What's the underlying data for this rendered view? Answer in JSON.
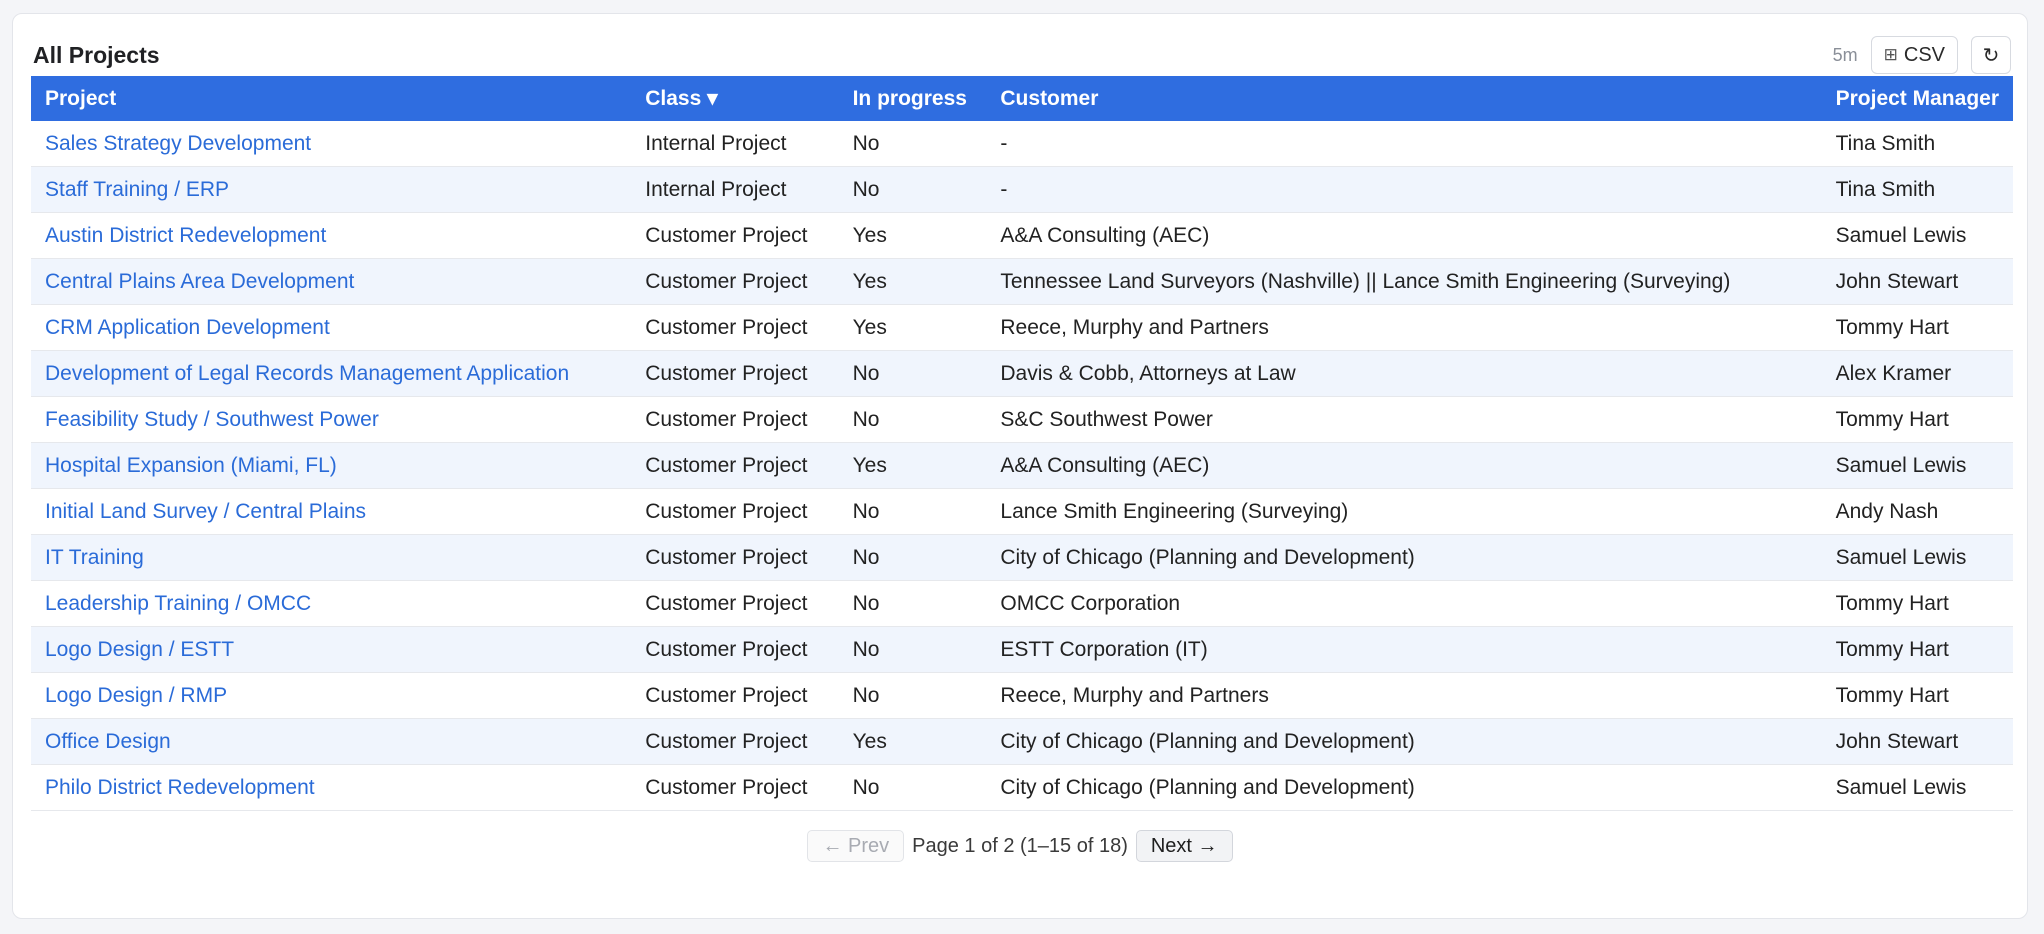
{
  "panel": {
    "title": "All Projects",
    "refresh_interval": "5m",
    "csv_icon": "grid-icon",
    "csv_glyph": "⊞",
    "csv_label": "CSV",
    "refresh_glyph": "↻"
  },
  "table": {
    "header_color": "#2f6de0",
    "columns": [
      "Project",
      "Class ▾",
      "In progress",
      "Customer",
      "Project Manager"
    ],
    "rows": [
      {
        "project": "Sales Strategy Development",
        "class": "Internal Project",
        "in_progress": "No",
        "customer": "-",
        "manager": "Tina Smith"
      },
      {
        "project": "Staff Training / ERP",
        "class": "Internal Project",
        "in_progress": "No",
        "customer": "-",
        "manager": "Tina Smith"
      },
      {
        "project": "Austin District Redevelopment",
        "class": "Customer Project",
        "in_progress": "Yes",
        "customer": "A&A Consulting (AEC)",
        "manager": "Samuel Lewis"
      },
      {
        "project": "Central Plains Area Development",
        "class": "Customer Project",
        "in_progress": "Yes",
        "customer": "Tennessee Land Surveyors (Nashville) || Lance Smith Engineering (Surveying)",
        "manager": "John Stewart"
      },
      {
        "project": "CRM Application Development",
        "class": "Customer Project",
        "in_progress": "Yes",
        "customer": "Reece, Murphy and Partners",
        "manager": "Tommy Hart"
      },
      {
        "project": "Development of Legal Records Management Application",
        "class": "Customer Project",
        "in_progress": "No",
        "customer": "Davis & Cobb, Attorneys at Law",
        "manager": "Alex Kramer"
      },
      {
        "project": "Feasibility Study / Southwest Power",
        "class": "Customer Project",
        "in_progress": "No",
        "customer": "S&C Southwest Power",
        "manager": "Tommy Hart"
      },
      {
        "project": "Hospital Expansion (Miami, FL)",
        "class": "Customer Project",
        "in_progress": "Yes",
        "customer": "A&A Consulting (AEC)",
        "manager": "Samuel Lewis"
      },
      {
        "project": "Initial Land Survey / Central Plains",
        "class": "Customer Project",
        "in_progress": "No",
        "customer": "Lance Smith Engineering (Surveying)",
        "manager": "Andy Nash"
      },
      {
        "project": "IT Training",
        "class": "Customer Project",
        "in_progress": "No",
        "customer": "City of Chicago (Planning and Development)",
        "manager": "Samuel Lewis"
      },
      {
        "project": "Leadership Training / OMCC",
        "class": "Customer Project",
        "in_progress": "No",
        "customer": "OMCC Corporation",
        "manager": "Tommy Hart"
      },
      {
        "project": "Logo Design / ESTT",
        "class": "Customer Project",
        "in_progress": "No",
        "customer": "ESTT Corporation (IT)",
        "manager": "Tommy Hart"
      },
      {
        "project": "Logo Design / RMP",
        "class": "Customer Project",
        "in_progress": "No",
        "customer": "Reece, Murphy and Partners",
        "manager": "Tommy Hart"
      },
      {
        "project": "Office Design",
        "class": "Customer Project",
        "in_progress": "Yes",
        "customer": "City of Chicago (Planning and Development)",
        "manager": "John Stewart"
      },
      {
        "project": "Philo District Redevelopment",
        "class": "Customer Project",
        "in_progress": "No",
        "customer": "City of Chicago (Planning and Development)",
        "manager": "Samuel Lewis"
      }
    ]
  },
  "pagination": {
    "prev_label": "← Prev",
    "status": "Page 1 of 2 (1–15 of 18)",
    "next_label": "Next →"
  }
}
